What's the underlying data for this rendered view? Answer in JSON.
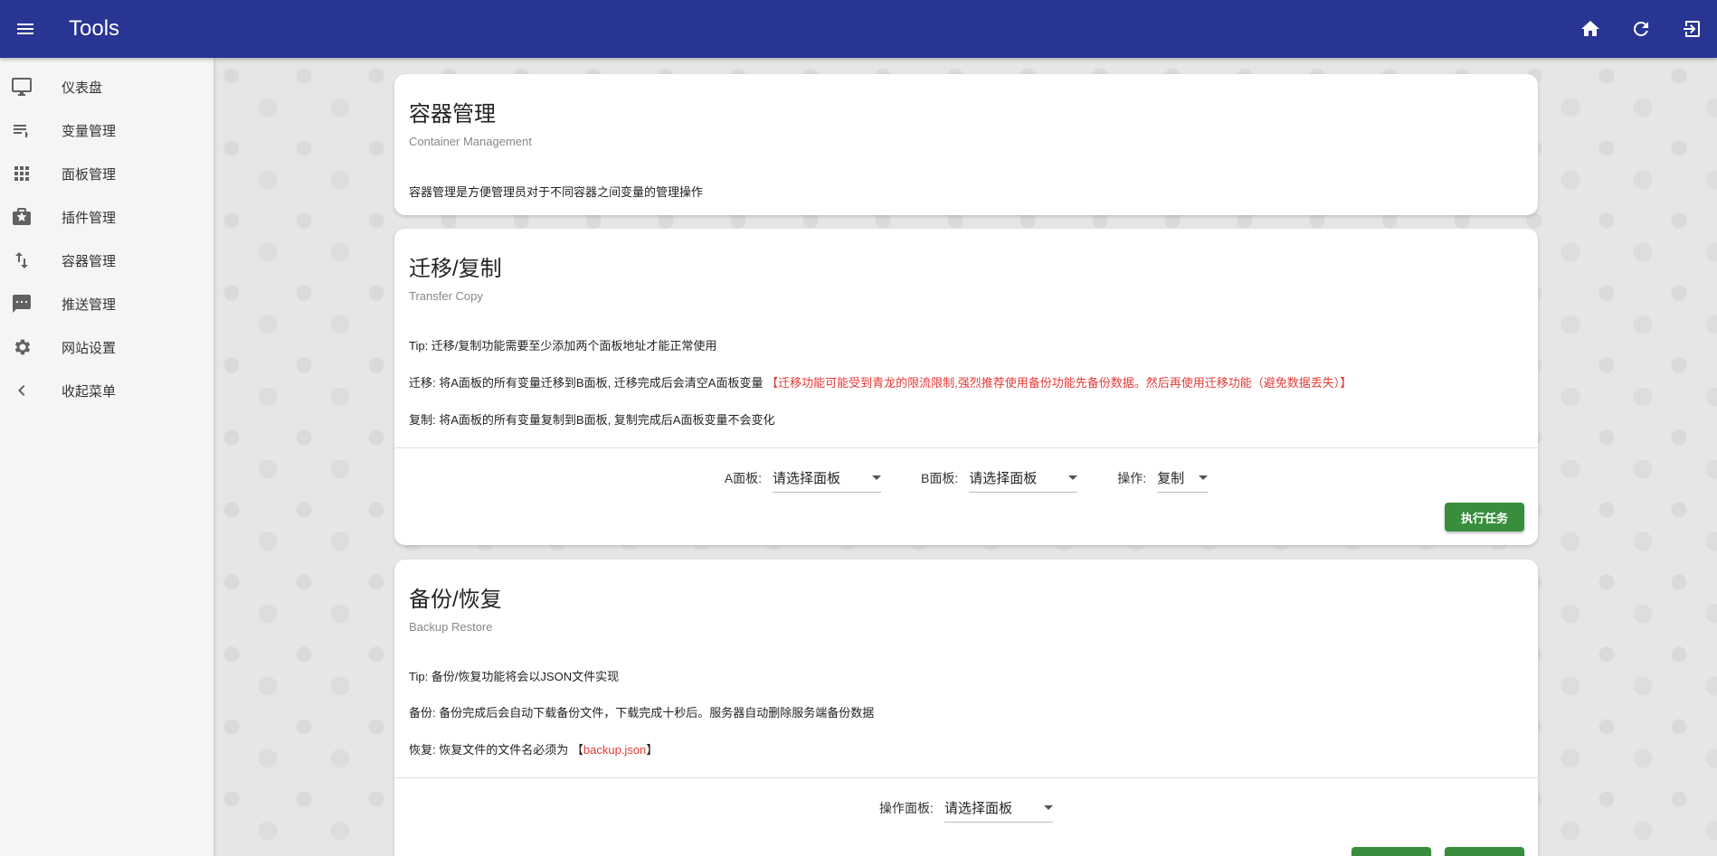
{
  "app": {
    "title": "Tools"
  },
  "sidebar": {
    "items": [
      {
        "label": "仪表盘",
        "icon": "monitor-icon"
      },
      {
        "label": "变量管理",
        "icon": "list-icon"
      },
      {
        "label": "面板管理",
        "icon": "apps-grid-icon"
      },
      {
        "label": "插件管理",
        "icon": "star-box-icon"
      },
      {
        "label": "容器管理",
        "icon": "swap-vertical-icon"
      },
      {
        "label": "推送管理",
        "icon": "chat-icon"
      },
      {
        "label": "网站设置",
        "icon": "gear-icon"
      },
      {
        "label": "收起菜单",
        "icon": "chevron-left-icon"
      }
    ]
  },
  "cards": {
    "container": {
      "title": "容器管理",
      "subtitle": "Container Management",
      "text": "容器管理是方便管理员对于不同容器之间变量的管理操作"
    },
    "transfer": {
      "title": "迁移/复制",
      "subtitle": "Transfer Copy",
      "tip": "Tip: 迁移/复制功能需要至少添加两个面板地址才能正常使用",
      "migrate": "迁移: 将A面板的所有变量迁移到B面板, 迁移完成后会清空A面板变量",
      "migrate_warn": "【迁移功能可能受到青龙的限流限制,强烈推荐使用备份功能先备份数据。然后再使用迁移功能（避免数据丢失）】",
      "copy": "复制: 将A面板的所有变量复制到B面板, 复制完成后A面板变量不会变化",
      "a_label": "A面板:",
      "a_value": "请选择面板",
      "b_label": "B面板:",
      "b_value": "请选择面板",
      "op_label": "操作:",
      "op_value": "复制",
      "run_button": "执行任务"
    },
    "backup": {
      "title": "备份/恢复",
      "subtitle": "Backup Restore",
      "tip": "Tip: 备份/恢复功能将会以JSON文件实现",
      "backup": "备份: 备份完成后会自动下载备份文件，下载完成十秒后。服务器自动删除服务端备份数据",
      "restore": "恢复: 恢复文件的文件名必须为",
      "restore_open": "【",
      "restore_file": "backup.json",
      "restore_close": "】",
      "panel_label": "操作面板:",
      "panel_value": "请选择面板"
    }
  },
  "colors": {
    "topbar": "#283593",
    "button": "#388e3c",
    "warning": "#e53935"
  }
}
